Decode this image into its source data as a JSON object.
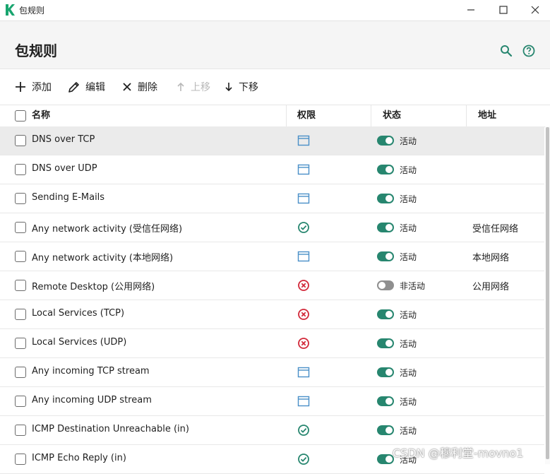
{
  "window": {
    "title": "包规则",
    "minimize_icon": "minimize-icon",
    "maximize_icon": "maximize-icon",
    "close_icon": "close-icon"
  },
  "header": {
    "title": "包规则",
    "search_icon": "search-icon",
    "help_icon": "help-icon"
  },
  "toolbar": {
    "add": "添加",
    "edit": "编辑",
    "delete": "删除",
    "move_up": "上移",
    "move_down": "下移"
  },
  "table": {
    "columns": {
      "name": "名称",
      "permission": "权限",
      "status": "状态",
      "address": "地址"
    },
    "rows": [
      {
        "name": "DNS over TCP",
        "permission": "app",
        "enabled": true,
        "status": "活动",
        "address": ""
      },
      {
        "name": "DNS over UDP",
        "permission": "app",
        "enabled": true,
        "status": "活动",
        "address": ""
      },
      {
        "name": "Sending E-Mails",
        "permission": "app",
        "enabled": true,
        "status": "活动",
        "address": ""
      },
      {
        "name": "Any network activity (受信任网络)",
        "permission": "allow",
        "enabled": true,
        "status": "活动",
        "address": "受信任网络"
      },
      {
        "name": "Any network activity (本地网络)",
        "permission": "app",
        "enabled": true,
        "status": "活动",
        "address": "本地网络"
      },
      {
        "name": "Remote Desktop (公用网络)",
        "permission": "block",
        "enabled": false,
        "status": "非活动",
        "address": "公用网络"
      },
      {
        "name": "Local Services (TCP)",
        "permission": "block",
        "enabled": true,
        "status": "活动",
        "address": ""
      },
      {
        "name": "Local Services (UDP)",
        "permission": "block",
        "enabled": true,
        "status": "活动",
        "address": ""
      },
      {
        "name": "Any incoming TCP stream",
        "permission": "app",
        "enabled": true,
        "status": "活动",
        "address": ""
      },
      {
        "name": "Any incoming UDP stream",
        "permission": "app",
        "enabled": true,
        "status": "活动",
        "address": ""
      },
      {
        "name": "ICMP Destination Unreachable (in)",
        "permission": "allow",
        "enabled": true,
        "status": "活动",
        "address": ""
      },
      {
        "name": "ICMP Echo Reply (in)",
        "permission": "allow",
        "enabled": true,
        "status": "活动",
        "address": ""
      }
    ]
  },
  "watermark": "CSDN @穆利堂-movno1",
  "colors": {
    "accent": "#27866f",
    "block": "#d2293a",
    "app_icon": "#4a90c8",
    "toggle_off": "#8f8f8f"
  }
}
